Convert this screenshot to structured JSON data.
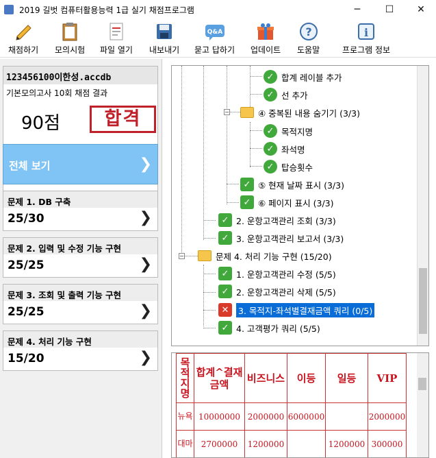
{
  "window": {
    "title": "2019 길벗 컴퓨터활용능력 1급 실기 채점프로그램"
  },
  "toolbar": [
    {
      "label": "채점하기",
      "icon": "pencil-icon"
    },
    {
      "label": "모의시험",
      "icon": "clipboard-icon"
    },
    {
      "label": "파일 열기",
      "icon": "file-open-icon"
    },
    {
      "label": "내보내기",
      "icon": "save-disk-icon"
    },
    {
      "label": "묻고 답하기",
      "icon": "qa-icon"
    },
    {
      "label": "업데이트",
      "icon": "gift-icon"
    },
    {
      "label": "도움말",
      "icon": "help-icon"
    },
    {
      "label": "프로그램 정보",
      "icon": "info-icon"
    }
  ],
  "result": {
    "filename": "123456100이한성.accdb",
    "subtitle": "기본모의고사 10회 채점 결과",
    "score": "90점",
    "stamp": "합격"
  },
  "all_view": "전체 보기",
  "problems": [
    {
      "title": "문제 1. DB 구축",
      "score": "25/30"
    },
    {
      "title": "문제 2. 입력 및 수정 기능 구현",
      "score": "25/25"
    },
    {
      "title": "문제 3. 조회 및 출력 기능 구현",
      "score": "25/25"
    },
    {
      "title": "문제 4. 처리 기능 구현",
      "score": "15/20"
    }
  ],
  "tree": [
    {
      "label": "합계 레이블 추가",
      "status": "pass-round"
    },
    {
      "label": "선 추가",
      "status": "pass-round"
    },
    {
      "label": "④ 중복된 내용 숨기기 (3/3)",
      "status": "folder-pass"
    },
    {
      "label": "목적지명",
      "status": "pass-round"
    },
    {
      "label": "좌석명",
      "status": "pass-round"
    },
    {
      "label": "탑승횟수",
      "status": "pass-round"
    },
    {
      "label": "⑤ 현재 날짜 표시 (3/3)",
      "status": "pass"
    },
    {
      "label": "⑥ 페이지 표시 (3/3)",
      "status": "pass"
    },
    {
      "label": "2. 운항고객관리 조회 (3/3)",
      "status": "pass"
    },
    {
      "label": "3. 운항고객관리 보고서 (3/3)",
      "status": "pass"
    },
    {
      "label": "문제 4. 처리 기능 구현 (15/20)",
      "status": "folder"
    },
    {
      "label": "1. 운항고객관리 수정 (5/5)",
      "status": "pass"
    },
    {
      "label": "2. 운항고객관리 삭제 (5/5)",
      "status": "pass"
    },
    {
      "label": "3. 목적지-좌석별결재금액 쿼리 (0/5)",
      "status": "fail"
    },
    {
      "label": "4. 고객평가 쿼리 (5/5)",
      "status": "pass"
    }
  ],
  "grid": {
    "headers": [
      "목적지명",
      "합계^결재금액",
      "비즈니스",
      "이등",
      "일등",
      "VIP"
    ],
    "rows": [
      [
        "뉴욕",
        "10000000",
        "2000000",
        "6000000",
        "",
        "2000000"
      ],
      [
        "대마",
        "2700000",
        "1200000",
        "",
        "1200000",
        "300000"
      ]
    ]
  },
  "colors": {
    "pass": "#41a83b",
    "fail": "#d93a2a",
    "selected": "#0a6cd6",
    "all_view_bg": "#7fc4f4",
    "stamp": "#c0202a"
  }
}
